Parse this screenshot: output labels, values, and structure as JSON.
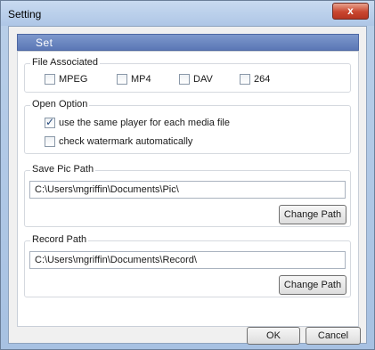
{
  "window": {
    "title": "Setting",
    "close_label": "x"
  },
  "header": {
    "label": "Set"
  },
  "file_associated": {
    "title": "File Associated",
    "options": [
      {
        "label": "MPEG",
        "checked": false
      },
      {
        "label": "MP4",
        "checked": false
      },
      {
        "label": "DAV",
        "checked": false
      },
      {
        "label": "264",
        "checked": false
      }
    ]
  },
  "open_option": {
    "title": "Open Option",
    "same_player": {
      "label": "use the same player for each media file",
      "checked": true
    },
    "watermark": {
      "label": "check watermark automatically",
      "checked": false
    }
  },
  "save_pic": {
    "title": "Save Pic Path",
    "path": "C:\\Users\\mgriffin\\Documents\\Pic\\",
    "button": "Change Path"
  },
  "record": {
    "title": "Record Path",
    "path": "C:\\Users\\mgriffin\\Documents\\Record\\",
    "button": "Change Path"
  },
  "footer": {
    "ok_label": "OK",
    "cancel_label": "Cancel"
  }
}
